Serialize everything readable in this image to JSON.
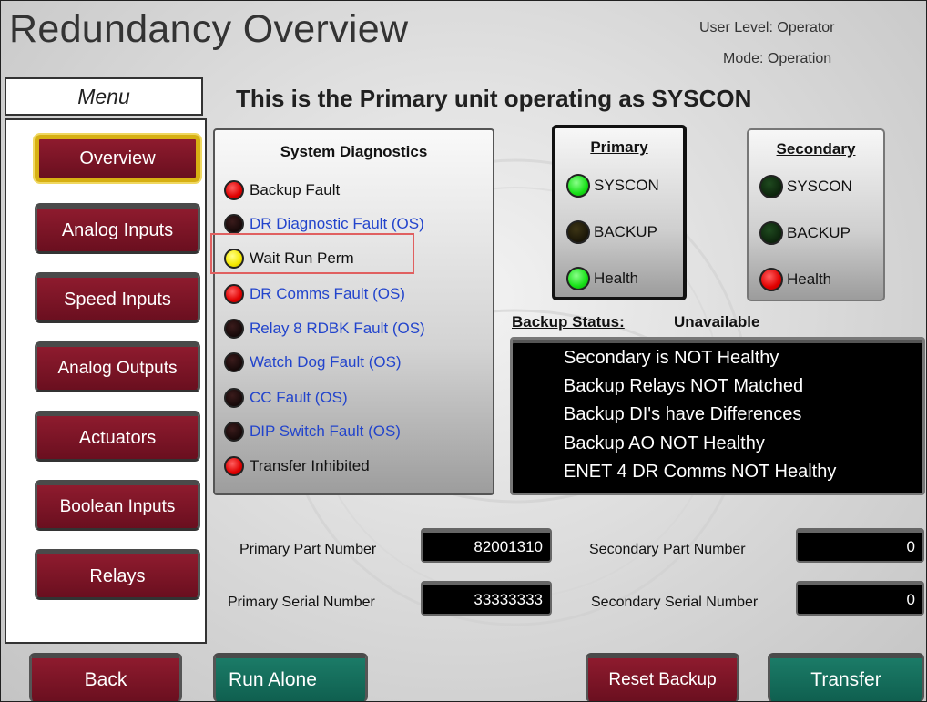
{
  "header": {
    "title": "Redundancy Overview",
    "user_level": "User Level: Operator",
    "mode": "Mode: Operation",
    "subtitle": "This is the Primary unit operating as SYSCON"
  },
  "menu": {
    "title": "Menu",
    "items": [
      {
        "label": "Overview",
        "selected": true
      },
      {
        "label": "Analog Inputs"
      },
      {
        "label": "Speed Inputs"
      },
      {
        "label": "Analog Outputs"
      },
      {
        "label": "Actuators"
      },
      {
        "label": "Boolean Inputs"
      },
      {
        "label": "Relays"
      }
    ]
  },
  "diagnostics": {
    "title": "System Diagnostics",
    "items": [
      {
        "label": "Backup Fault",
        "led": "red",
        "text_color": "black"
      },
      {
        "label": "DR Diagnostic Fault (OS)",
        "led": "off",
        "text_color": "blue"
      },
      {
        "label": "Wait Run Perm",
        "led": "yellow",
        "text_color": "black",
        "highlighted": true
      },
      {
        "label": "DR Comms Fault (OS)",
        "led": "red",
        "text_color": "blue"
      },
      {
        "label": "Relay 8 RDBK Fault (OS)",
        "led": "off",
        "text_color": "blue"
      },
      {
        "label": "Watch Dog Fault (OS)",
        "led": "off",
        "text_color": "blue"
      },
      {
        "label": "CC Fault (OS)",
        "led": "off",
        "text_color": "blue"
      },
      {
        "label": "DIP Switch Fault (OS)",
        "led": "off",
        "text_color": "blue"
      },
      {
        "label": "Transfer Inhibited",
        "led": "red",
        "text_color": "black"
      }
    ]
  },
  "primary": {
    "title": "Primary",
    "rows": [
      {
        "label": "SYSCON",
        "led": "green"
      },
      {
        "label": "BACKUP",
        "led": "off"
      },
      {
        "label": "Health",
        "led": "green"
      }
    ]
  },
  "secondary": {
    "title": "Secondary",
    "rows": [
      {
        "label": "SYSCON",
        "led": "off"
      },
      {
        "label": "BACKUP",
        "led": "off"
      },
      {
        "label": "Health",
        "led": "red"
      }
    ]
  },
  "backup_status": {
    "label": "Backup Status:",
    "value": "Unavailable",
    "messages": [
      "Secondary is NOT Healthy",
      "Backup Relays NOT Matched",
      "Backup DI's have Differences",
      "Backup AO NOT Healthy",
      "ENET 4 DR Comms NOT Healthy"
    ]
  },
  "part_info": {
    "primary_part_label": "Primary Part Number",
    "primary_part_value": "82001310",
    "primary_serial_label": "Primary Serial Number",
    "primary_serial_value": "33333333",
    "secondary_part_label": "Secondary Part Number",
    "secondary_part_value": "0",
    "secondary_serial_label": "Secondary Serial Number",
    "secondary_serial_value": "0"
  },
  "buttons": {
    "back": "Back",
    "run_alone": "Run Alone",
    "reset_backup": "Reset Backup",
    "transfer": "Transfer"
  },
  "colors": {
    "button_red": "#7c1426",
    "button_green": "#156d5a",
    "selected_border": "#d7b013",
    "diag_blue_text": "#2244cc",
    "highlight_box": "#e06060"
  }
}
